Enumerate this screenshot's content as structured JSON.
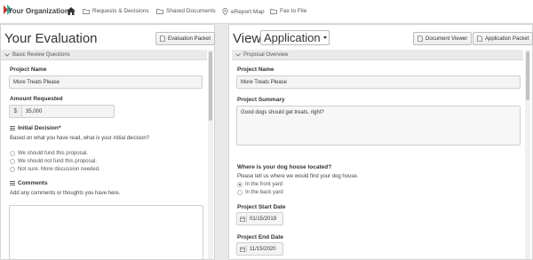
{
  "nav": {
    "org_name": "Your Organization",
    "items": [
      {
        "label": "",
        "icon": "home-icon"
      },
      {
        "label": "Requests & Decisions",
        "icon": "folder-icon"
      },
      {
        "label": "Shared Documents",
        "icon": "folder-icon"
      },
      {
        "label": "eReport Map",
        "icon": "map-icon"
      },
      {
        "label": "Fax to File",
        "icon": "folder-icon"
      }
    ]
  },
  "left": {
    "title": "Your Evaluation",
    "evaluation_packet_label": "Evaluation Packet",
    "section_title": "Basic Review Questions",
    "project_name_label": "Project Name",
    "project_name_value": "More Treats Please",
    "amount_label": "Amount Requested",
    "currency_symbol": "$",
    "amount_value": "35,000",
    "decision_label": "Initial Decision*",
    "decision_prompt": "Based on what you have read, what is your initial decision?",
    "decision_options": [
      "We should fund this proposal.",
      "We should not fund this proposal.",
      "Not sure. More discussion needed."
    ],
    "comments_label": "Comments",
    "comments_prompt": "Add any comments or thoughts you have here.",
    "comments_value": ""
  },
  "right": {
    "view_label": "View",
    "view_select": "Application",
    "document_viewer_label": "Document Viewer",
    "application_packet_label": "Application Packet",
    "section_title": "Proposal Overview",
    "project_name_label": "Project Name",
    "project_name_value": "More Treats Please",
    "summary_label": "Project Summary",
    "summary_value": "Good dogs should get treats, right?",
    "location_label": "Where is your dog house located?",
    "location_prompt": "Please tell us where we would find your dog house.",
    "location_options": [
      "In the front yard",
      "In the back yard"
    ],
    "location_selected": 0,
    "start_label": "Project Start Date",
    "start_value": "01/15/2019",
    "end_label": "Project End Date",
    "end_value": "11/15/2020"
  },
  "colors": {
    "accent_red": "#c0392b",
    "accent_teal": "#2a9d8f",
    "section_bg": "#eaeaea"
  }
}
